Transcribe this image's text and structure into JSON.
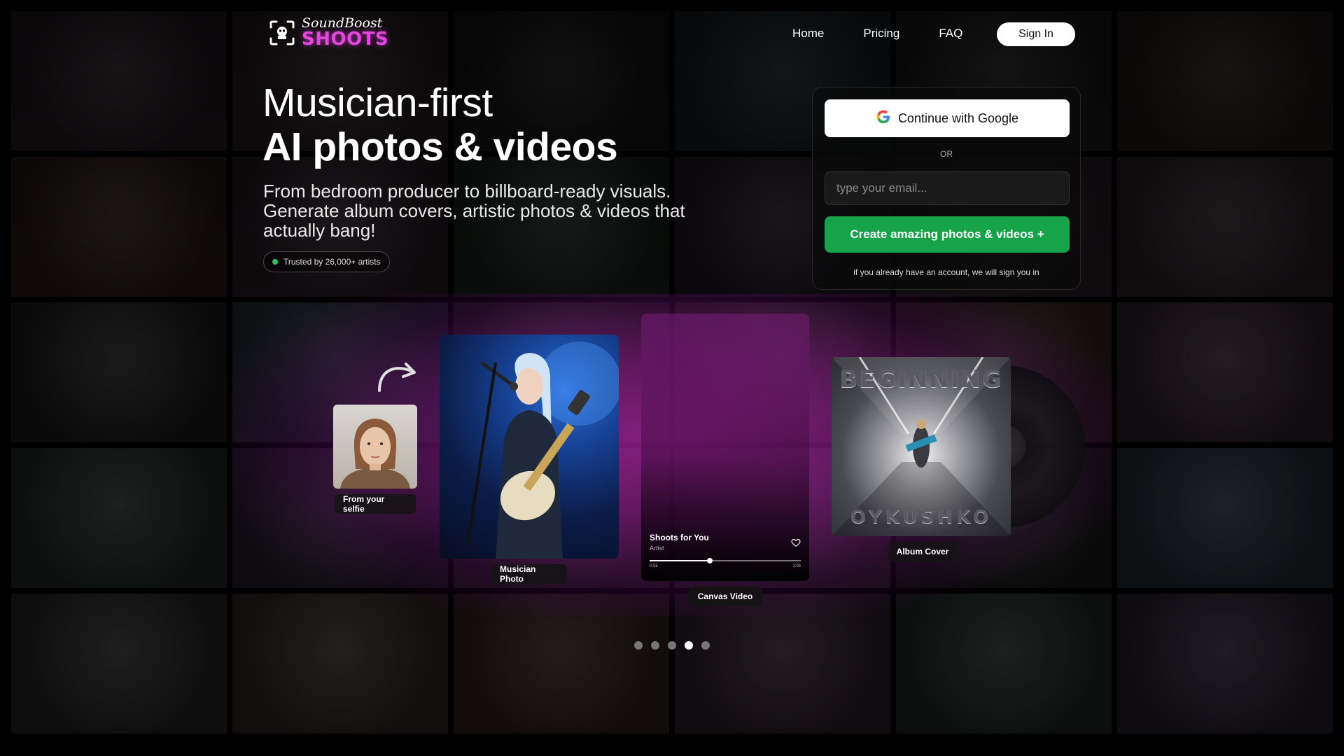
{
  "logo": {
    "top": "SoundBoost",
    "bottom": "SHOOTS"
  },
  "nav": {
    "items": [
      "Home",
      "Pricing",
      "FAQ"
    ],
    "signin_label": "Sign In"
  },
  "hero": {
    "title_line1": "Musician-first",
    "title_line2": "AI photos & videos",
    "subtitle": "From bedroom producer to billboard-ready visuals. Generate album covers, artistic photos & videos that actually bang!",
    "trust_text": "Trusted by 26,000+ artists"
  },
  "auth": {
    "google_label": "Continue with Google",
    "or_text": "OR",
    "email_placeholder": "type your email...",
    "create_label": "Create amazing photos & videos +",
    "note": "if you already have an account, we will sign you in"
  },
  "showcase": {
    "selfie_label": "From your selfie",
    "musician_label": "Musician Photo",
    "video_label": "Canvas Video",
    "album_label": "Album Cover",
    "player": {
      "title": "Shoots for You",
      "artist": "Artist",
      "time_start": "0:55",
      "time_end": "1:05",
      "progress": 0.4
    },
    "album": {
      "top_text": "BEGINNING",
      "bottom_text": "OYKUSHKO"
    }
  },
  "carousel": {
    "count": 5,
    "active_index": 3
  },
  "colors": {
    "accent_pink": "#e546e0",
    "cta_green": "#16a34a",
    "trust_dot": "#22c55e",
    "glow": "#be28b4"
  }
}
